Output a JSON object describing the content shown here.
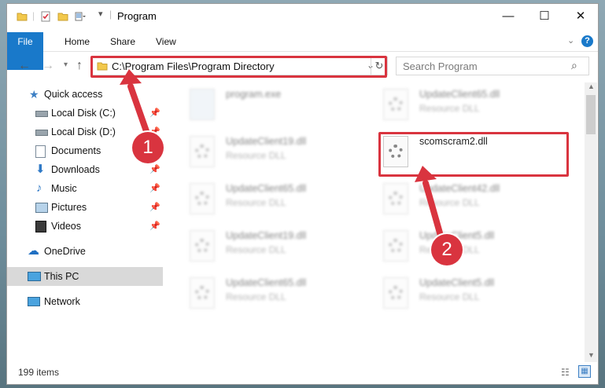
{
  "window": {
    "title": "Program",
    "minimize": "—",
    "maximize": "☐",
    "close": "✕"
  },
  "ribbon": {
    "tabs": [
      "File",
      "Home",
      "Share",
      "View"
    ],
    "help": "?"
  },
  "navigation": {
    "address": "C:\\Program Files\\Program Directory",
    "search_placeholder": "Search Program"
  },
  "sidebar": {
    "items": [
      {
        "label": "Quick access",
        "icon": "star-icon",
        "pinned": false
      },
      {
        "label": "Local Disk (C:)",
        "icon": "drive-icon",
        "pinned": true
      },
      {
        "label": "Local Disk (D:)",
        "icon": "drive-icon",
        "pinned": true
      },
      {
        "label": "Documents",
        "icon": "documents-icon",
        "pinned": true
      },
      {
        "label": "Downloads",
        "icon": "download-icon",
        "pinned": true
      },
      {
        "label": "Music",
        "icon": "music-icon",
        "pinned": true
      },
      {
        "label": "Pictures",
        "icon": "pictures-icon",
        "pinned": true
      },
      {
        "label": "Videos",
        "icon": "videos-icon",
        "pinned": true
      },
      {
        "label": "OneDrive",
        "icon": "cloud-icon",
        "pinned": false
      },
      {
        "label": "This PC",
        "icon": "computer-icon",
        "pinned": false,
        "selected": true
      },
      {
        "label": "Network",
        "icon": "network-icon",
        "pinned": false
      }
    ]
  },
  "files": [
    {
      "name": "program.exe",
      "type": ""
    },
    {
      "name": "UpdateClient65.dll",
      "type": "Resource DLL"
    },
    {
      "name": "UpdateClient19.dll",
      "type": "Resource DLL"
    },
    {
      "name": "scomscram2.dll",
      "type": "",
      "highlighted": true
    },
    {
      "name": "UpdateClient65.dll",
      "type": "Resource DLL"
    },
    {
      "name": "UpdateClient42.dll",
      "type": "Resource DLL"
    },
    {
      "name": "UpdateClient19.dll",
      "type": "Resource DLL"
    },
    {
      "name": "UpdateClient5.dll",
      "type": "Resource DLL"
    },
    {
      "name": "UpdateClient65.dll",
      "type": "Resource DLL"
    },
    {
      "name": "UpdateClient5.dll",
      "type": "Resource DLL"
    }
  ],
  "status": {
    "item_count": "199 items"
  },
  "callouts": [
    "1",
    "2"
  ],
  "colors": {
    "accent": "#1979ca",
    "highlight": "#d9343f"
  }
}
